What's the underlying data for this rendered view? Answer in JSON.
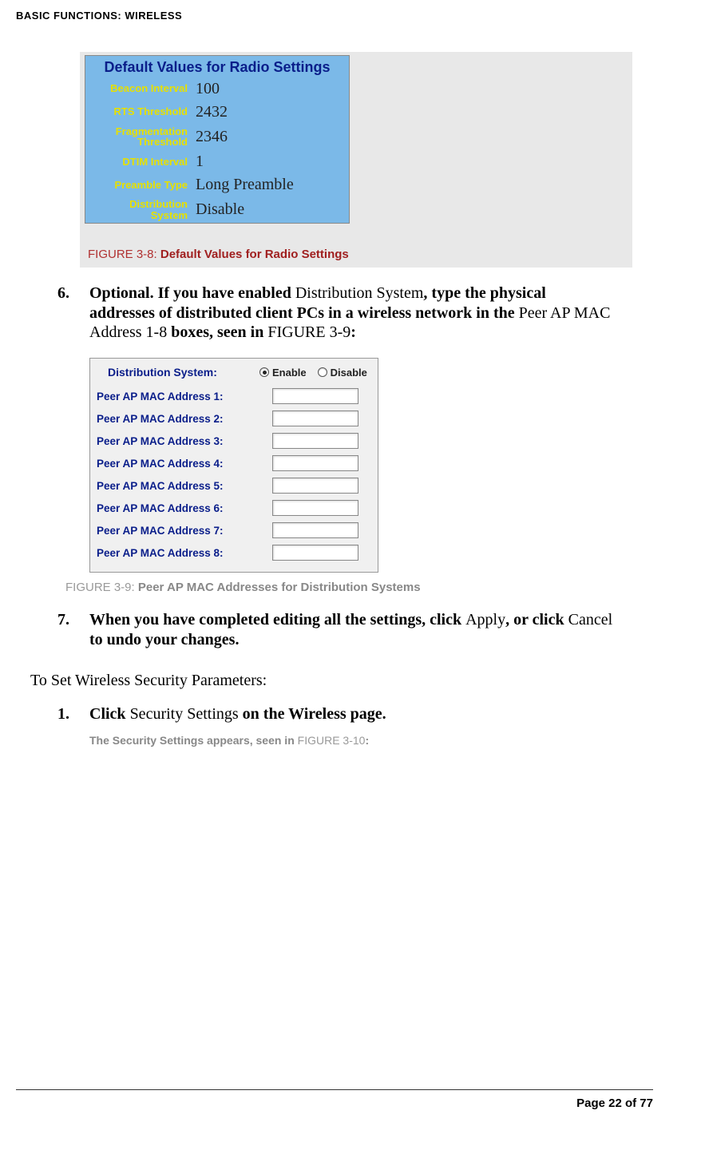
{
  "header": "BASIC FUNCTIONS: WIRELESS",
  "figure1": {
    "panel_title": "Default Values for Radio Settings",
    "rows": [
      {
        "label": "Beacon Interval",
        "value": "100"
      },
      {
        "label": "RTS Threshold",
        "value": "2432"
      },
      {
        "label": "Fragmentation Threshold",
        "value": "2346"
      },
      {
        "label": "DTIM Interval",
        "value": "1"
      },
      {
        "label": "Preamble Type",
        "value": "Long Preamble"
      },
      {
        "label": "Distribution System",
        "value": "Disable"
      }
    ],
    "caption_num": "FIGURE 3-8:",
    "caption_title": "Default Values for Radio Settings"
  },
  "step6": {
    "num": "6.",
    "t1": "Optional. If you have enabled ",
    "t2": "Distribution System",
    "t3": ", type the physical addresses of distributed client PCs in a wireless network in the ",
    "t4": "Peer AP MAC Address 1-8 ",
    "t5": "boxes, seen in ",
    "t6": "FIGURE 3-9",
    "t7": ":"
  },
  "figure2": {
    "header_label": "Distribution System:",
    "enable": "Enable",
    "disable": "Disable",
    "mac_rows": [
      "Peer AP MAC Address 1:",
      "Peer AP MAC Address 2:",
      "Peer AP MAC Address 3:",
      "Peer AP MAC Address 4:",
      "Peer AP MAC Address 5:",
      "Peer AP MAC Address 6:",
      "Peer AP MAC Address 7:",
      "Peer AP MAC Address 8:"
    ],
    "caption_num": "FIGURE 3-9:",
    "caption_title": "Peer AP MAC Addresses for Distribution Systems"
  },
  "step7": {
    "num": "7.",
    "t1": "When you have completed editing all the settings, click ",
    "t2": "Apply",
    "t3": ", or click ",
    "t4": "Cancel",
    "t5": " to undo your changes."
  },
  "section_lead": "To Set Wireless Security Parameters:",
  "step1": {
    "num": "1.",
    "t1": "Click ",
    "t2": "Security Settings",
    "t3": " on the Wireless page."
  },
  "note": {
    "t1": "The Security Settings appears, seen in ",
    "t2": "FIGURE 3-10",
    "t3": ":"
  },
  "footer": "Page 22 of 77"
}
